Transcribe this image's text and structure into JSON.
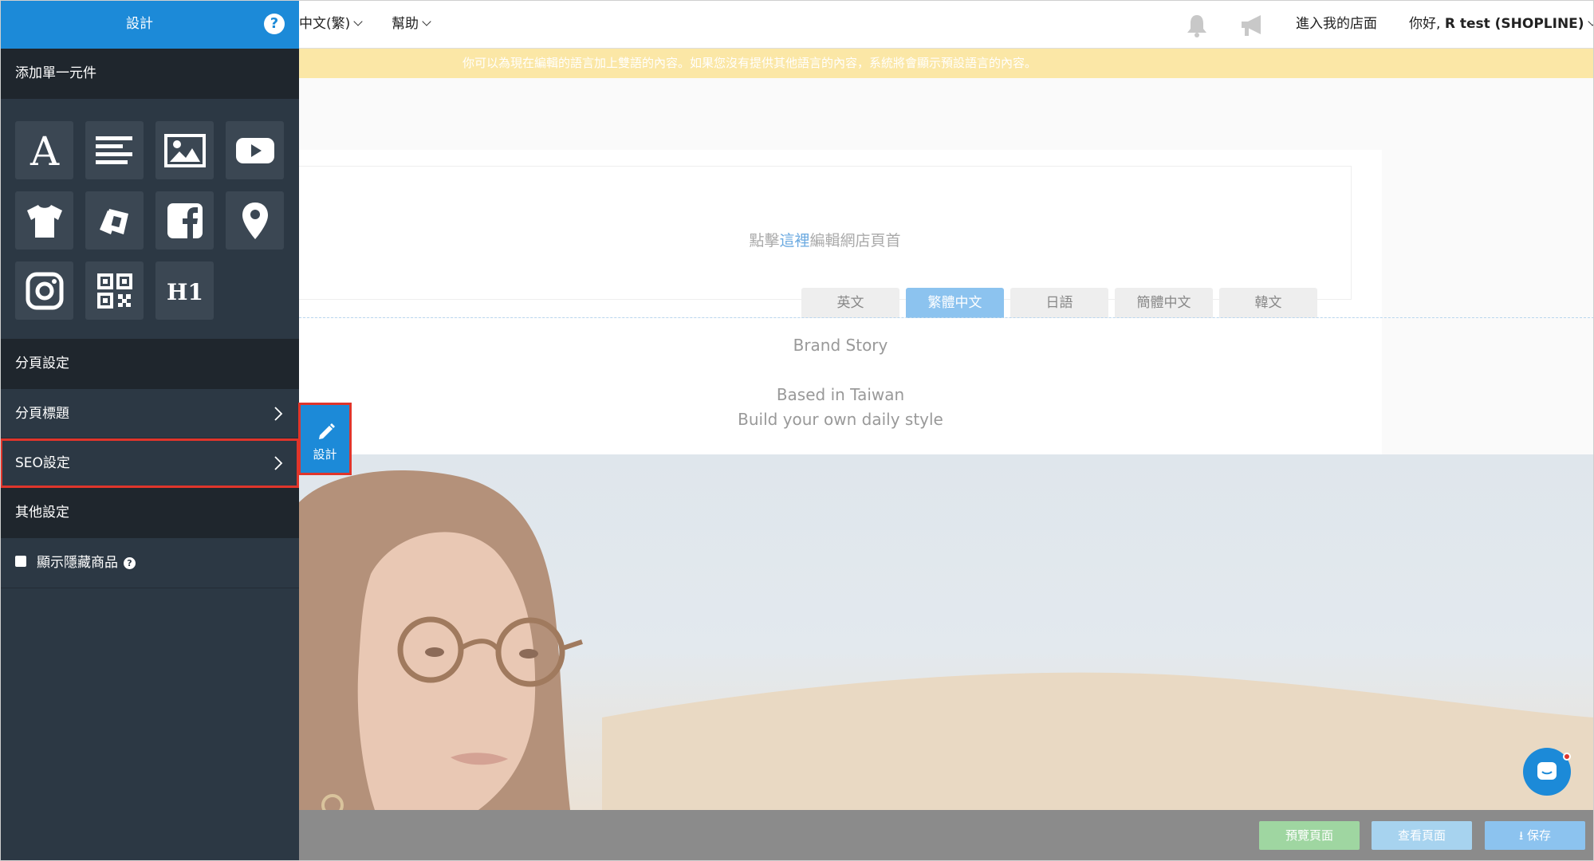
{
  "sidebar": {
    "title": "設計",
    "help_icon": "question-circle-icon",
    "add_element_label": "添加單一元件",
    "tiles": [
      {
        "icon": "text-icon"
      },
      {
        "icon": "paragraph-icon"
      },
      {
        "icon": "image-icon"
      },
      {
        "icon": "youtube-icon"
      },
      {
        "icon": "tshirt-product-icon"
      },
      {
        "icon": "gallery-icon"
      },
      {
        "icon": "facebook-icon"
      },
      {
        "icon": "map-pin-icon"
      },
      {
        "icon": "instagram-icon"
      },
      {
        "icon": "qr-code-icon"
      },
      {
        "icon": "h1-heading-icon"
      }
    ],
    "page_settings_label": "分頁設定",
    "page_title_label": "分頁標題",
    "seo_label": "SEO設定",
    "other_settings_label": "其他設定",
    "show_hidden_label": "顯示隱藏商品",
    "show_hidden_checked": false
  },
  "float_button": {
    "label": "設計",
    "icon": "pencil-icon"
  },
  "topbar": {
    "language": "中文(繁)",
    "help": "幫助",
    "enter_store": "進入我的店面",
    "greeting": "你好,",
    "user": "R test (SHOPLINE)"
  },
  "notice": "你可以為現在編輯的語言加上雙語的內容。如果您沒有提供其他語言的內容，系統將會顯示預設語言的內容。",
  "header_placeholder": {
    "before": "點擊",
    "link": "這裡",
    "after": "編輯網店頁首"
  },
  "language_tabs": [
    {
      "label": "英文",
      "active": false
    },
    {
      "label": "繁體中文",
      "active": true
    },
    {
      "label": "日語",
      "active": false
    },
    {
      "label": "簡體中文",
      "active": false
    },
    {
      "label": "韓文",
      "active": false
    }
  ],
  "brand": {
    "title": "Brand Story",
    "line1": "Based in Taiwan",
    "line2": "Build your own daily style"
  },
  "footer": {
    "preview": "預覽頁面",
    "view": "查看頁面",
    "save": "保存"
  },
  "colors": {
    "accent": "#1c8ad8",
    "sidebar_bg": "#2c3844",
    "highlight_border": "#e0352b",
    "notice_bg": "#fbe7a6",
    "preview_btn": "#9fd6a1",
    "view_btn": "#a7d3ef",
    "save_btn": "#8cc3ef"
  }
}
